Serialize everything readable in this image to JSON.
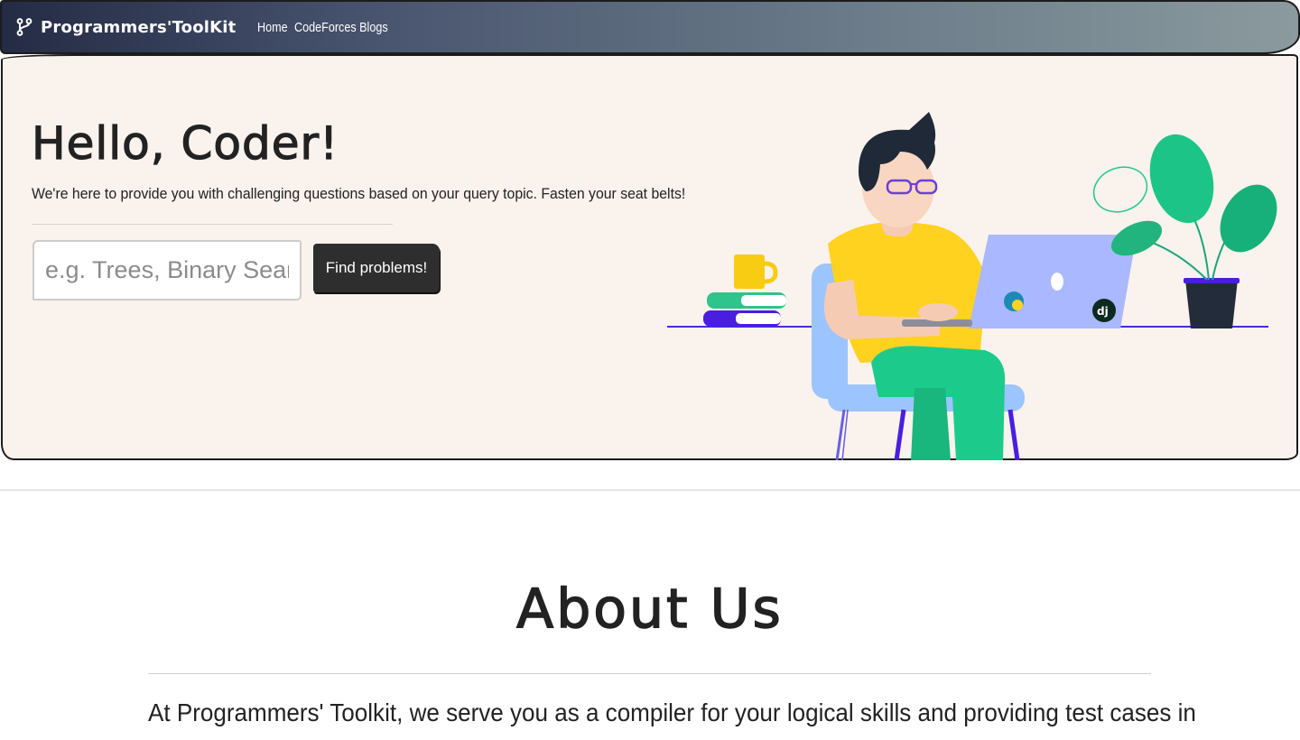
{
  "navbar": {
    "brand": "Programmers'ToolKit",
    "brand_icon": "git-branch-icon",
    "links": [
      {
        "label": "Home"
      },
      {
        "label": "CodeForces Blogs"
      }
    ]
  },
  "hero": {
    "title": "Hello, Coder!",
    "lead": "We're here to provide you with challenging questions based on your query topic. Fasten your seat belts!",
    "search": {
      "placeholder": "e.g. Trees, Binary Search, ..",
      "value": ""
    },
    "button_label": "Find problems!",
    "illustration": "developer-at-laptop-illustration"
  },
  "about": {
    "title": "About Us",
    "text": "At Programmers' Toolkit, we serve you as a compiler for your logical skills and providing test cases in"
  },
  "colors": {
    "hero_bg": "#faf2ec",
    "button_bg": "#2e2e2e",
    "nav_gradient_start": "#242b45",
    "nav_gradient_end": "#8a9a9e"
  }
}
